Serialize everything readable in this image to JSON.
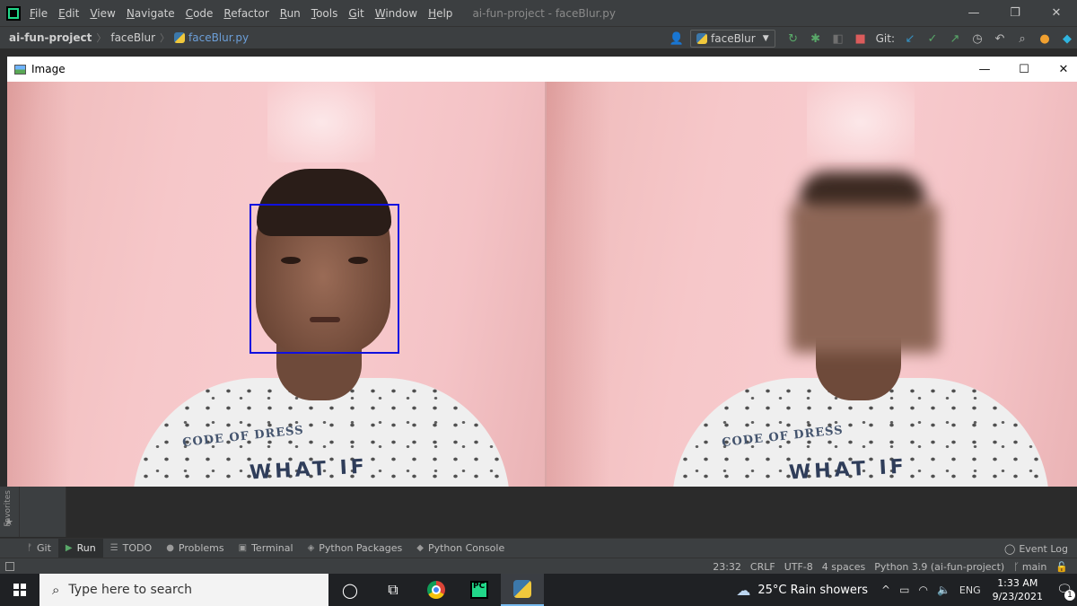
{
  "ide": {
    "menu": [
      "File",
      "Edit",
      "View",
      "Navigate",
      "Code",
      "Refactor",
      "Run",
      "Tools",
      "Git",
      "Window",
      "Help"
    ],
    "window_title": "ai-fun-project - faceBlur.py",
    "breadcrumb": {
      "project": "ai-fun-project",
      "folder": "faceBlur",
      "file": "faceBlur.py"
    },
    "run_config": "faceBlur",
    "git_label": "Git:"
  },
  "image_window": {
    "title": "Image",
    "shirt_text_1": "CODE OF DRESS",
    "shirt_text_2": "WHAT IF"
  },
  "favorites_label": "Favorites",
  "tool_tabs": [
    {
      "label": "Git",
      "icon": "git-icon"
    },
    {
      "label": "Run",
      "icon": "run-icon"
    },
    {
      "label": "TODO",
      "icon": "todo-icon"
    },
    {
      "label": "Problems",
      "icon": "problems-icon"
    },
    {
      "label": "Terminal",
      "icon": "terminal-icon"
    },
    {
      "label": "Python Packages",
      "icon": "packages-icon"
    },
    {
      "label": "Python Console",
      "icon": "console-icon"
    }
  ],
  "event_log": "Event Log",
  "status": {
    "position": "23:32",
    "line_sep": "CRLF",
    "encoding": "UTF-8",
    "indent": "4 spaces",
    "interpreter": "Python 3.9 (ai-fun-project)",
    "branch": "main"
  },
  "taskbar": {
    "search_placeholder": "Type here to search",
    "weather": "25°C  Rain showers",
    "language": "ENG",
    "time": "1:33 AM",
    "date": "9/23/2021",
    "notif_count": "1"
  }
}
